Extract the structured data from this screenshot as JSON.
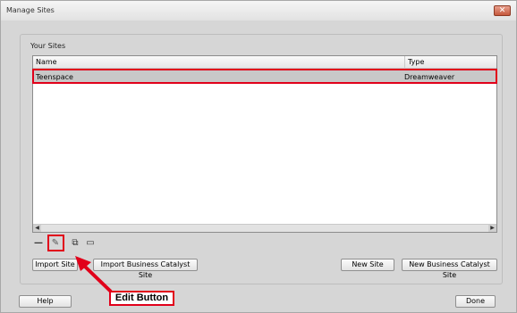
{
  "window": {
    "title": "Manage Sites",
    "close_label": "✕"
  },
  "sites_section": {
    "title": "Your Sites",
    "columns": {
      "name": "Name",
      "type": "Type"
    },
    "rows": [
      {
        "name": "Teenspace",
        "type": "Dreamweaver"
      }
    ]
  },
  "toolbar": {
    "remove_glyph": "—",
    "edit_glyph": "✎",
    "duplicate_glyph": "⧉",
    "export_glyph": "▭"
  },
  "buttons": {
    "import_site": "Import Site",
    "import_bc_site": "Import Business Catalyst Site",
    "new_site": "New Site",
    "new_bc_site": "New Business Catalyst Site",
    "help": "Help",
    "done": "Done"
  },
  "annotation": {
    "callout": "Edit Button",
    "color": "#e1001a"
  }
}
